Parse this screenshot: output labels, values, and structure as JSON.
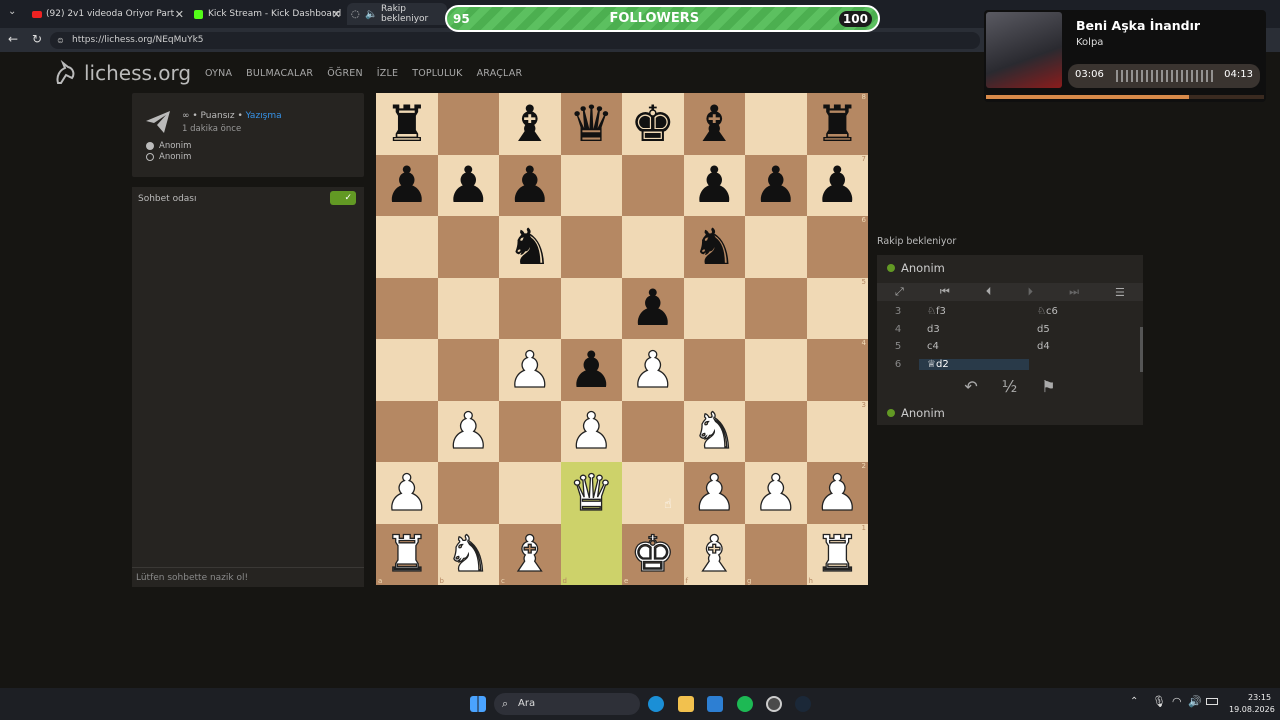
{
  "browser": {
    "tabs": [
      {
        "label": "(92) 2v1 videoda Oriyor Part",
        "active": false
      },
      {
        "label": "Kick Stream - Kick Dashboard",
        "active": false
      },
      {
        "label": "Rakip bekleniyor",
        "active": true
      }
    ],
    "url": "https://lichess.org/NEqMuYk5"
  },
  "site": {
    "logo": "lichess.org",
    "nav": [
      "OYNA",
      "BULMACALAR",
      "ÖĞREN",
      "İZLE",
      "TOPLULUK",
      "ARAÇLAR"
    ]
  },
  "game_info": {
    "mode_line_prefix": "∞ • Puansız • ",
    "mode_link": "Yazışma",
    "time": "1 dakika önce",
    "players": [
      "Anonim",
      "Anonim"
    ]
  },
  "chat": {
    "title": "Sohbet odası",
    "footer": "Lütfen sohbette nazik ol!"
  },
  "board": {
    "ranks": [
      "8",
      "7",
      "6",
      "5",
      "4",
      "3",
      "2",
      "1"
    ],
    "files": [
      "a",
      "b",
      "c",
      "d",
      "e",
      "f",
      "g",
      "h"
    ],
    "position": [
      [
        "br",
        "",
        "bb",
        "bq",
        "bk",
        "bb",
        "",
        "br"
      ],
      [
        "bp",
        "bp",
        "bp",
        "",
        "",
        "bp",
        "bp",
        "bp"
      ],
      [
        "",
        "",
        "bn",
        "",
        "",
        "bn",
        "",
        ""
      ],
      [
        "",
        "",
        "",
        "",
        "bp",
        "",
        "",
        ""
      ],
      [
        "",
        "",
        "wp",
        "bp",
        "wp",
        "",
        "",
        ""
      ],
      [
        "",
        "wp",
        "",
        "wp",
        "",
        "wn",
        "",
        ""
      ],
      [
        "wp",
        "",
        "",
        "wq",
        "",
        "wp",
        "wp",
        "wp"
      ],
      [
        "wr",
        "wn",
        "wb",
        "",
        "wk",
        "wb",
        "",
        "wr"
      ]
    ],
    "highlight": [
      "d2",
      "d1"
    ]
  },
  "panel": {
    "status": "Rakip bekleniyor",
    "top_player": "Anonim",
    "bottom_player": "Anonim",
    "moves": [
      {
        "n": "3",
        "w": "♘f3",
        "b": "♘c6"
      },
      {
        "n": "4",
        "w": "d3",
        "b": "d5"
      },
      {
        "n": "5",
        "w": "c4",
        "b": "d4"
      },
      {
        "n": "6",
        "w": "♕d2",
        "b": ""
      }
    ],
    "draw_label": "½"
  },
  "overlay": {
    "left": "95",
    "label": "FOLLOWERS",
    "right": "100"
  },
  "music": {
    "title": "Beni Aşka İnandır",
    "artist": "Kolpa",
    "elapsed": "03:06",
    "total": "04:13",
    "progress": 0.73
  },
  "taskbar": {
    "search": "Ara",
    "time": "23:15",
    "date": "19.08.2026"
  }
}
